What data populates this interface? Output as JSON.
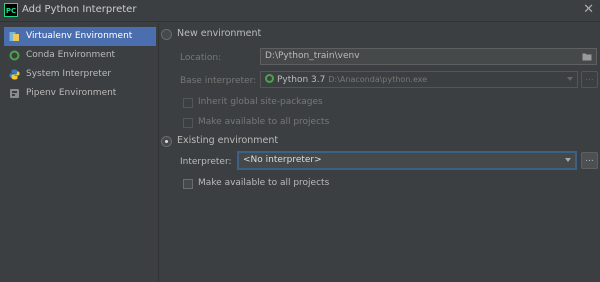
{
  "window": {
    "title": "Add Python Interpreter",
    "app_icon_text": "PC",
    "close_symbol": "✕"
  },
  "sidebar": {
    "items": [
      {
        "label": "Virtualenv Environment",
        "icon": "virtualenv-icon",
        "selected": true
      },
      {
        "label": "Conda Environment",
        "icon": "conda-icon",
        "selected": false
      },
      {
        "label": "System Interpreter",
        "icon": "python-icon",
        "selected": false
      },
      {
        "label": "Pipenv Environment",
        "icon": "pipenv-icon",
        "selected": false
      }
    ]
  },
  "new_env": {
    "radio_label": "New environment",
    "checked": false,
    "location_label": "Location:",
    "location_value": "D:\\Python_train\\venv",
    "base_label": "Base interpreter:",
    "base_version": "Python 3.7",
    "base_path": "D:\\Anaconda\\python.exe",
    "inherit_label": "Inherit global site-packages",
    "available_label": "Make available to all projects"
  },
  "existing_env": {
    "radio_label": "Existing environment",
    "checked": true,
    "interpreter_label": "Interpreter:",
    "interpreter_value": "<No interpreter>",
    "available_label": "Make available to all projects",
    "ellipsis_label": "..."
  },
  "colors": {
    "background": "#3c3f41",
    "selection": "#4b6eaf",
    "focus_border": "#3d6185",
    "conda_green": "#4ca34a"
  }
}
